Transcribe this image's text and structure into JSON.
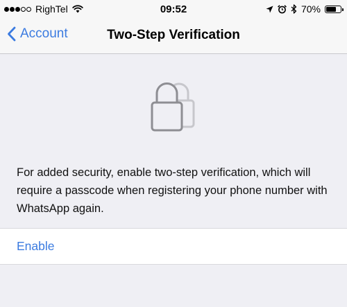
{
  "status_bar": {
    "carrier": "RighTel",
    "time": "09:52",
    "battery_percent_label": "70%",
    "battery_level": 0.7,
    "signal_bars_filled": 3,
    "signal_bars_total": 5
  },
  "nav": {
    "back_label": "Account",
    "title": "Two-Step Verification"
  },
  "content": {
    "description": "For added security, enable two-step verification, which will require a passcode when registering your phone number with WhatsApp again.",
    "enable_label": "Enable"
  },
  "icons": [
    "wifi-icon",
    "location-arrow-icon",
    "alarm-clock-icon",
    "bluetooth-icon",
    "battery-icon",
    "back-chevron-icon",
    "padlock-icon"
  ],
  "colors": {
    "accent": "#3b7be0",
    "background": "#efeff4",
    "bar": "#f7f7f7"
  }
}
